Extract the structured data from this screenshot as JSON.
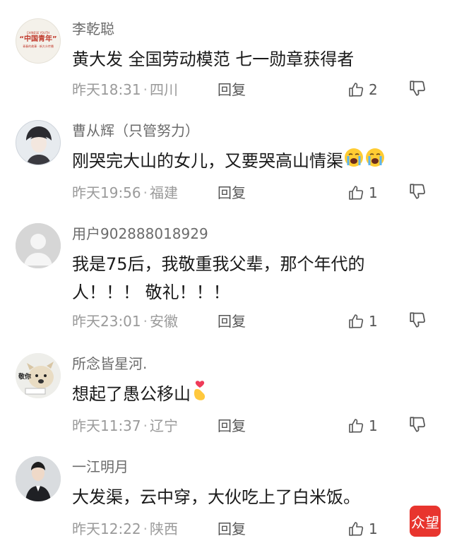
{
  "comments": [
    {
      "username": "李乾聪",
      "content": "黄大发  全国劳动模范 七一勋章获得者",
      "time": "昨天18:31",
      "location": "四川",
      "reply_label": "回复",
      "likes": "2",
      "avatar": {
        "icon": "china-youth-logo",
        "title": "“中国青年”",
        "top": "CHINESE YOUTH",
        "sub": "青春的故事 · 新大众传播"
      }
    },
    {
      "username": "曹从辉（只管努力）",
      "content": "刚哭完大山的女儿，又要哭高山情渠",
      "emoji": "loudly-crying-face",
      "time": "昨天19:56",
      "location": "福建",
      "reply_label": "回复",
      "likes": "1",
      "avatar": {
        "icon": "anime-boy-avatar"
      }
    },
    {
      "username": "用户902888018929",
      "content": "我是75后，我敬重我父辈，那个年代的人！！！ 敬礼！！！",
      "time": "昨天23:01",
      "location": "安徽",
      "reply_label": "回复",
      "likes": "1",
      "avatar": {
        "icon": "default-user-avatar"
      }
    },
    {
      "username": "所念皆星河.",
      "content": "想起了愚公移山",
      "emoji": "finger-heart",
      "time": "昨天11:37",
      "location": "辽宁",
      "reply_label": "回复",
      "likes": "1",
      "avatar": {
        "icon": "dog-avatar",
        "label": "敬你"
      }
    },
    {
      "username": "一江明月",
      "content": "大发渠，云中穿，大伙吃上了白米饭。",
      "time": "昨天12:22",
      "location": "陕西",
      "reply_label": "回复",
      "likes": "1",
      "avatar": {
        "icon": "man-in-suit-avatar"
      }
    }
  ],
  "watermark": {
    "text": "众望",
    "icon": "brand-logo"
  },
  "colors": {
    "text": "#1a1a1a",
    "meta": "#9a9a9a",
    "username": "#6b6b6b",
    "brand": "#e8352e"
  }
}
